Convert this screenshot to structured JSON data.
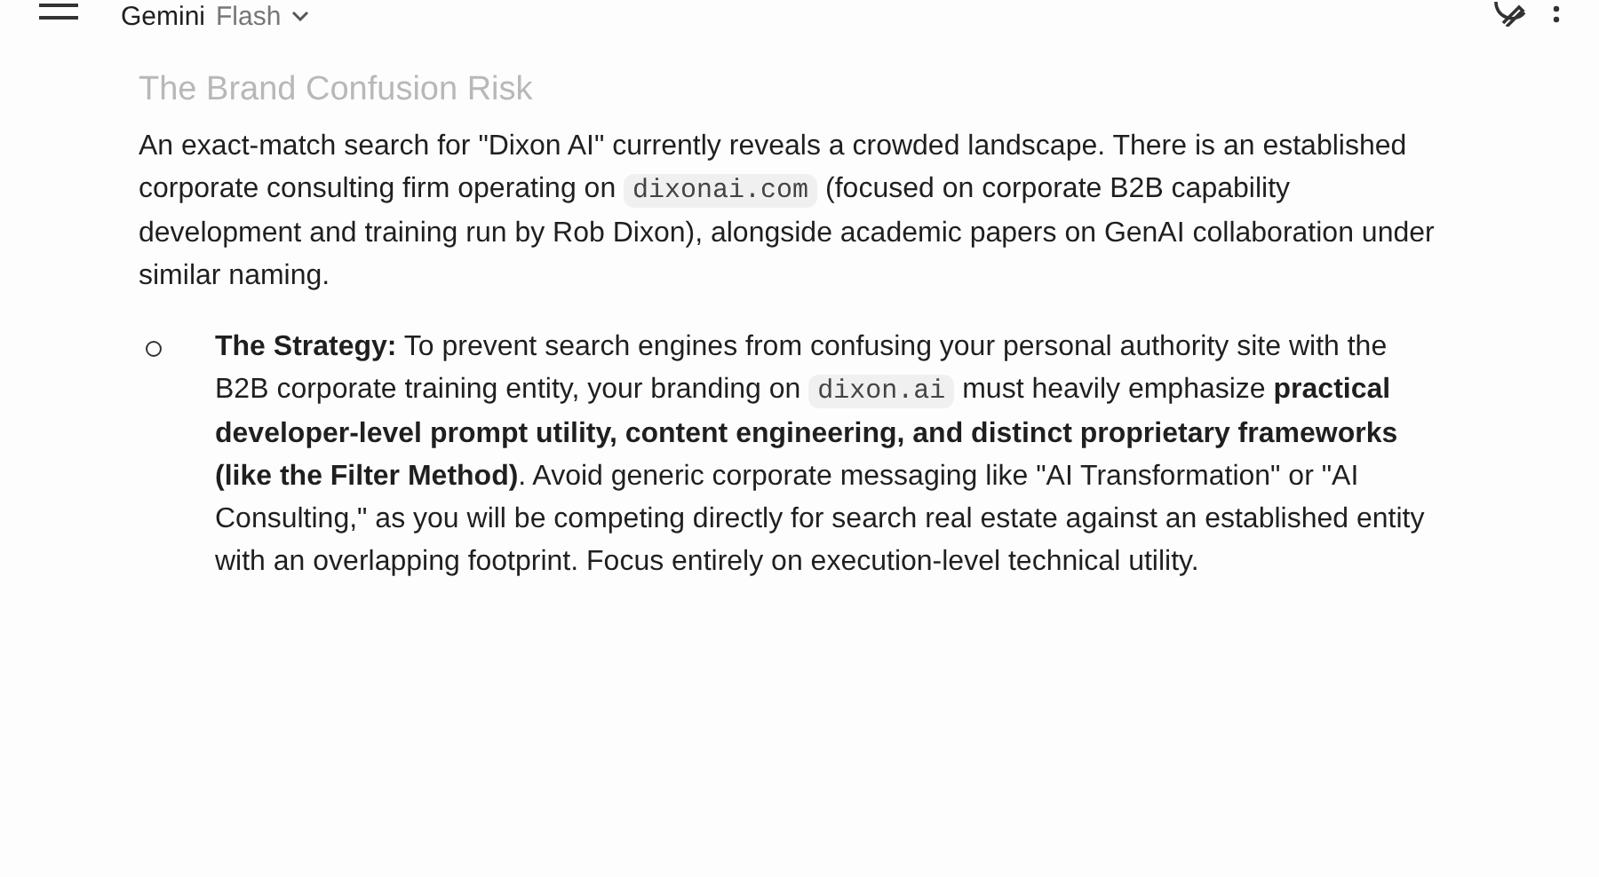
{
  "header": {
    "app_name": "Gemini",
    "model": "Flash"
  },
  "heading": "The Brand Confusion Risk",
  "paragraph": [
    {
      "kind": "text",
      "text": "An exact-match search for \"Dixon AI\" currently reveals a crowded landscape. There is an established corporate consulting firm operating on "
    },
    {
      "kind": "code",
      "text": "dixonai.com"
    },
    {
      "kind": "text",
      "text": " (focused on corporate B2B capability development and training run by Rob Dixon), alongside academic papers on GenAI collaboration under similar naming."
    }
  ],
  "bullets": [
    {
      "parts": [
        {
          "kind": "bold",
          "text": "The Strategy:"
        },
        {
          "kind": "text",
          "text": " To prevent search engines from confusing your personal authority site with the B2B corporate training entity, your branding on "
        },
        {
          "kind": "code",
          "text": "dixon.ai"
        },
        {
          "kind": "text",
          "text": " must heavily emphasize "
        },
        {
          "kind": "bold",
          "text": "practical developer-level prompt utility, content engineering, and distinct proprietary frameworks (like the Filter Method)"
        },
        {
          "kind": "text",
          "text": ". Avoid generic corporate messaging like \"AI Transformation\" or \"AI Consulting,\" as you will be competing directly for search real estate against an established entity with an overlapping footprint. Focus entirely on execution-level technical utility."
        }
      ]
    }
  ]
}
